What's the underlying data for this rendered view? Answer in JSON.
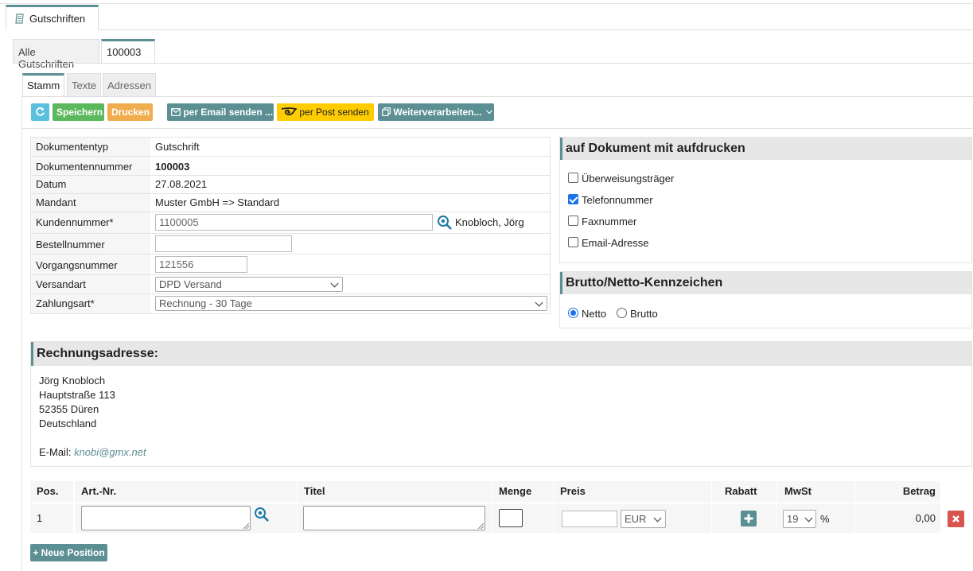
{
  "top_tab": {
    "label": "Gutschriften"
  },
  "tabs2": [
    {
      "label": "Alle Gutschriften"
    },
    {
      "label": "100003"
    }
  ],
  "tabs3": [
    {
      "label": "Stamm"
    },
    {
      "label": "Texte"
    },
    {
      "label": "Adressen"
    }
  ],
  "toolbar": {
    "save": "Speichern",
    "print": "Drucken",
    "email": "per Email senden ...",
    "post": "per Post senden",
    "more": "Weiterverarbeiten..."
  },
  "form": {
    "doctype_label": "Dokumententyp",
    "doctype_value": "Gutschrift",
    "docnum_label": "Dokumentennummer",
    "docnum_value": "100003",
    "date_label": "Datum",
    "date_value": "27.08.2021",
    "mandant_label": "Mandant",
    "mandant_value": "Muster GmbH => Standard",
    "customer_label": "Kundennummer*",
    "customer_value": "1100005",
    "customer_name": "Knobloch, Jörg",
    "order_label": "Bestellnummer",
    "order_value": "",
    "process_label": "Vorgangsnummer",
    "process_value": "121556",
    "shipping_label": "Versandart",
    "shipping_value": "DPD Versand",
    "payment_label": "Zahlungsart*",
    "payment_value": "Rechnung - 30 Tage"
  },
  "print_panel": {
    "title": "auf Dokument mit aufdrucken",
    "options": [
      {
        "label": "Überweisungsträger",
        "checked": false
      },
      {
        "label": "Telefonnummer",
        "checked": true
      },
      {
        "label": "Faxnummer",
        "checked": false
      },
      {
        "label": "Email-Adresse",
        "checked": false
      }
    ]
  },
  "gross_net_panel": {
    "title": "Brutto/Netto-Kennzeichen",
    "net": "Netto",
    "gross": "Brutto",
    "selected": "Netto"
  },
  "address": {
    "title": "Rechnungsadresse:",
    "name": "Jörg Knobloch",
    "street": "Hauptstraße 113",
    "city": "52355 Düren",
    "country": "Deutschland",
    "email_label": "E-Mail:",
    "email": "knobi@gmx.net"
  },
  "positions": {
    "headers": [
      "Pos.",
      "Art.-Nr.",
      "Titel",
      "Menge",
      "Preis",
      "Rabatt",
      "MwSt",
      "Betrag"
    ],
    "rows": [
      {
        "pos": "1",
        "currency": "EUR",
        "vat": "19",
        "vat_unit": "%",
        "amount": "0,00"
      }
    ],
    "add_button": "+ Neue Position"
  },
  "colors": {
    "accent": "#5b8f93",
    "save": "#5cb85c",
    "print": "#f0ad4e",
    "post": "#ffcc00",
    "refresh": "#5bc0de",
    "delete": "#d9534f"
  }
}
